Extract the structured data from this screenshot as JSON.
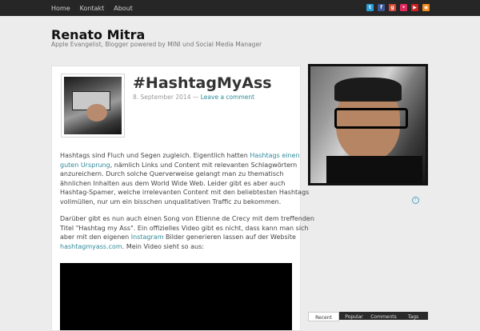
{
  "nav": {
    "items": [
      "Home",
      "Kontakt",
      "About"
    ]
  },
  "social": {
    "icons": [
      "twitter-icon",
      "facebook-icon",
      "googleplus-icon",
      "flickr-icon",
      "youtube-icon",
      "rss-icon"
    ],
    "colors": [
      "#2a9fd6",
      "#3b5998",
      "#d34836",
      "#e02a5e",
      "#cc2222",
      "#f28c1d"
    ]
  },
  "site": {
    "title": "Renato Mitra",
    "tagline": "Apple Evangelist, Blogger powered by MINI und Social Media Manager"
  },
  "post": {
    "title": "#HashtagMyAss",
    "date": "8. September 2014",
    "separator": "—",
    "comment_link": "Leave a comment",
    "p1_a": "Hashtags sind Fluch und Segen zugleich. Eigentlich hatten ",
    "p1_link": "Hashtags einen guten Ursprung",
    "p1_b": ", nämlich Links und Content mit relevanten Schlagwörtern anzureichern. Durch solche Querverweise gelangt man zu thematisch ähnlichen Inhalten aus dem World Wide Web. Leider gibt es aber auch Hashtag-Spamer, welche irrelevanten Content mit den beliebtesten Hashtags vollmüllen, nur um ein bisschen unqualitativen Traffic zu bekommen.",
    "p2_a": "Darüber gibt es nun auch einen Song von Etienne de Crecy mit dem treffenden Titel \"Hashtag my Ass\". Ein offizielles Video gibt es nicht, dass kann man sich aber mit den eigenen ",
    "p2_link1": "Instagram",
    "p2_b": " Bilder generieren lassen auf der Website ",
    "p2_link2": "hashtagmyass.com",
    "p2_c": ". Mein Video sieht so aus:"
  },
  "sidebar": {
    "tabs": [
      "Recent",
      "Popular",
      "Comments",
      "Tags"
    ]
  }
}
